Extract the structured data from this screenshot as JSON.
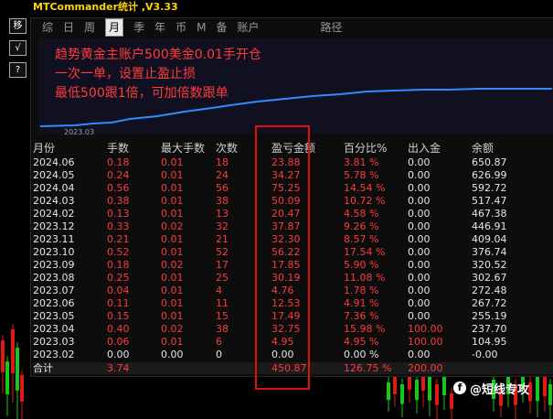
{
  "window": {
    "title": "MTCommander统计 ,V3.33"
  },
  "side_buttons": [
    "移",
    "√",
    "?"
  ],
  "tabs": [
    {
      "label": "综",
      "active": false
    },
    {
      "label": "日",
      "active": false
    },
    {
      "label": "周",
      "active": false
    },
    {
      "label": "月",
      "active": true
    },
    {
      "label": "季",
      "active": false
    },
    {
      "label": "年",
      "active": false
    },
    {
      "label": "币",
      "active": false
    },
    {
      "label": "M",
      "active": false
    },
    {
      "label": "备",
      "active": false
    },
    {
      "label": "账户",
      "active": false
    },
    {
      "label": "路径",
      "active": false
    }
  ],
  "notes": [
    "趋势黄金主账户500美金0.01手开仓",
    "一次一单，设置止盈止损",
    "最低500跟1倍，可加倍数跟单"
  ],
  "chart": {
    "x_tick": "2023.03",
    "line_color": "#2f8cff"
  },
  "table": {
    "headers": [
      "月份",
      "手数",
      "最大手数",
      "次数",
      "盈亏金额",
      "百分比%",
      "出入金",
      "余额"
    ],
    "rows": [
      [
        "2024.06",
        "0.18",
        "0.01",
        "18",
        "23.88",
        "3.81 %",
        "0.00",
        "650.87"
      ],
      [
        "2024.05",
        "0.24",
        "0.01",
        "24",
        "34.27",
        "5.78 %",
        "0.00",
        "626.99"
      ],
      [
        "2024.04",
        "0.56",
        "0.01",
        "56",
        "75.25",
        "14.54 %",
        "0.00",
        "592.72"
      ],
      [
        "2024.03",
        "0.38",
        "0.01",
        "38",
        "50.09",
        "10.72 %",
        "0.00",
        "517.47"
      ],
      [
        "2024.02",
        "0.13",
        "0.01",
        "13",
        "20.47",
        "4.58 %",
        "0.00",
        "467.38"
      ],
      [
        "2023.12",
        "0.33",
        "0.02",
        "32",
        "37.87",
        "9.26 %",
        "0.00",
        "446.91"
      ],
      [
        "2023.11",
        "0.21",
        "0.01",
        "21",
        "32.30",
        "8.57 %",
        "0.00",
        "409.04"
      ],
      [
        "2023.10",
        "0.52",
        "0.01",
        "52",
        "56.22",
        "17.54 %",
        "0.00",
        "376.74"
      ],
      [
        "2023.09",
        "0.18",
        "0.02",
        "17",
        "17.85",
        "5.90 %",
        "0.00",
        "320.52"
      ],
      [
        "2023.08",
        "0.25",
        "0.01",
        "25",
        "30.19",
        "11.08 %",
        "0.00",
        "302.67"
      ],
      [
        "2023.07",
        "0.04",
        "0.01",
        "4",
        "4.76",
        "1.78 %",
        "0.00",
        "272.48"
      ],
      [
        "2023.06",
        "0.11",
        "0.01",
        "11",
        "12.53",
        "4.91 %",
        "0.00",
        "267.72"
      ],
      [
        "2023.05",
        "0.15",
        "0.01",
        "15",
        "17.49",
        "7.36 %",
        "0.00",
        "255.19"
      ],
      [
        "2023.04",
        "0.40",
        "0.02",
        "38",
        "32.75",
        "15.98 %",
        "100.00",
        "237.70"
      ],
      [
        "2023.03",
        "0.06",
        "0.01",
        "6",
        "4.95",
        "4.95 %",
        "100.00",
        "104.95"
      ],
      [
        "2023.02",
        "0.00",
        "0.00",
        "0",
        "0.00",
        "0.00 %",
        "0.00",
        "-0.00"
      ]
    ],
    "total": [
      "合计",
      "3.74",
      "",
      "",
      "450.87",
      "126.75 %",
      "200.00",
      ""
    ]
  },
  "watermark": {
    "icon": "facebook-icon",
    "text": "@短线专攻"
  },
  "colors": {
    "profit": "#ff3a3a",
    "highlight_box": "#e01010",
    "note_text": "#ff3b3b"
  }
}
